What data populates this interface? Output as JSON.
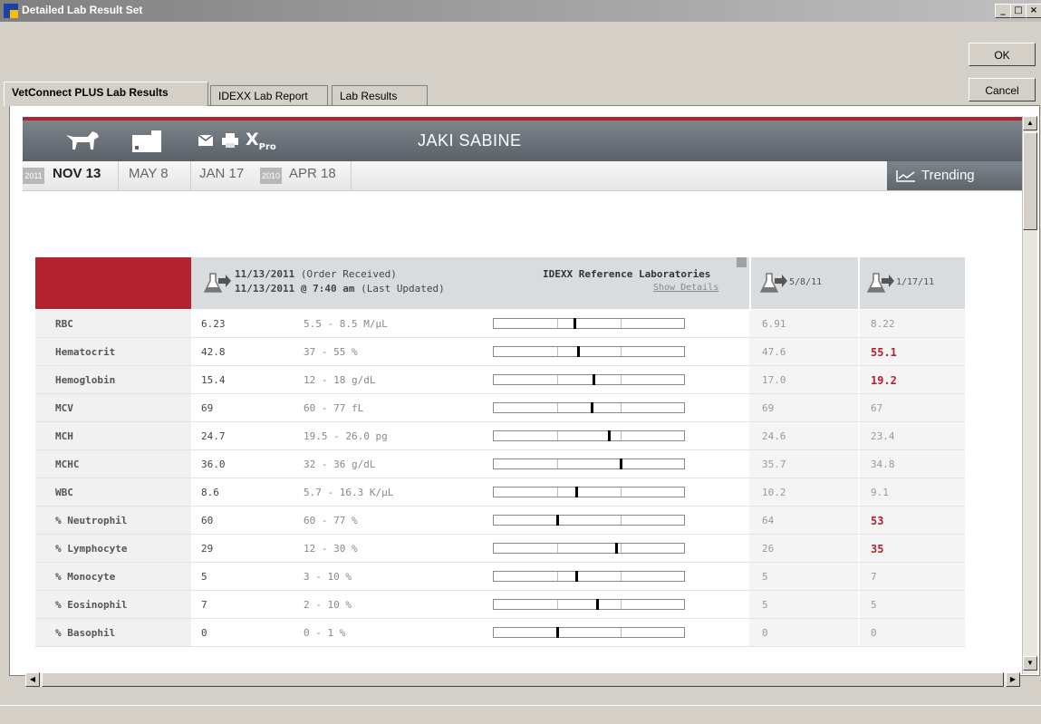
{
  "window": {
    "title": "Detailed Lab Result Set",
    "min": "_",
    "max": "□",
    "close": "×"
  },
  "dialog": {
    "ok": "OK",
    "cancel": "Cancel"
  },
  "tabs": [
    "VetConnect PLUS Lab Results",
    "IDEXX Lab Report",
    "Lab Results"
  ],
  "topbar": {
    "icons": [
      "dog-icon",
      "card-icon",
      "email-icon",
      "print-icon",
      "xpro-icon"
    ],
    "xpro_label": "Pro",
    "patient_name": "JAKI SABINE"
  },
  "dates": {
    "year_2011": "2011",
    "year_2010": "2010",
    "items": [
      "NOV 13",
      "MAY 8",
      "JAN 17",
      "APR 18"
    ],
    "trending": "Trending"
  },
  "header": {
    "order_date": "11/13/2011",
    "order_suffix": "(Order Received)",
    "updated": "11/13/2011 @ 7:40 am",
    "updated_suffix": "(Last Updated)",
    "lab": "IDEXX Reference Laboratories",
    "show_details": "Show Details",
    "prev1": "5/8/11",
    "prev2": "1/17/11"
  },
  "rows": [
    {
      "name": "RBC",
      "value": "6.23",
      "range": "5.5 - 8.5 M/µL",
      "marker": 0.42,
      "prev1": "6.91",
      "prev2": "8.22",
      "prev2_flag": false
    },
    {
      "name": "Hematocrit",
      "value": "42.8",
      "range": "37 - 55 %",
      "marker": 0.44,
      "prev1": "47.6",
      "prev2": "55.1",
      "prev2_flag": true
    },
    {
      "name": "Hemoglobin",
      "value": "15.4",
      "range": "12 - 18 g/dL",
      "marker": 0.52,
      "prev1": "17.0",
      "prev2": "19.2",
      "prev2_flag": true
    },
    {
      "name": "MCV",
      "value": "69",
      "range": "60 - 77 fL",
      "marker": 0.51,
      "prev1": "69",
      "prev2": "67",
      "prev2_flag": false
    },
    {
      "name": "MCH",
      "value": "24.7",
      "range": "19.5 - 26.0 pg",
      "marker": 0.6,
      "prev1": "24.6",
      "prev2": "23.4",
      "prev2_flag": false
    },
    {
      "name": "MCHC",
      "value": "36.0",
      "range": "32 - 36 g/dL",
      "marker": 0.66,
      "prev1": "35.7",
      "prev2": "34.8",
      "prev2_flag": false
    },
    {
      "name": "WBC",
      "value": "8.6",
      "range": "5.7 - 16.3 K/µL",
      "marker": 0.43,
      "prev1": "10.2",
      "prev2": "9.1",
      "prev2_flag": false
    },
    {
      "name": "% Neutrophil",
      "value": "60",
      "range": "60 - 77 %",
      "marker": 0.33,
      "prev1": "64",
      "prev2": "53",
      "prev2_flag": true
    },
    {
      "name": "% Lymphocyte",
      "value": "29",
      "range": "12 - 30 %",
      "marker": 0.64,
      "prev1": "26",
      "prev2": "35",
      "prev2_flag": true
    },
    {
      "name": "% Monocyte",
      "value": "5",
      "range": "3 - 10 %",
      "marker": 0.43,
      "prev1": "5",
      "prev2": "7",
      "prev2_flag": false
    },
    {
      "name": "% Eosinophil",
      "value": "7",
      "range": "2 - 10 %",
      "marker": 0.54,
      "prev1": "5",
      "prev2": "5",
      "prev2_flag": false
    },
    {
      "name": "% Basophil",
      "value": "0",
      "range": "0 - 1 %",
      "marker": 0.33,
      "prev1": "0",
      "prev2": "0",
      "prev2_flag": false
    }
  ]
}
